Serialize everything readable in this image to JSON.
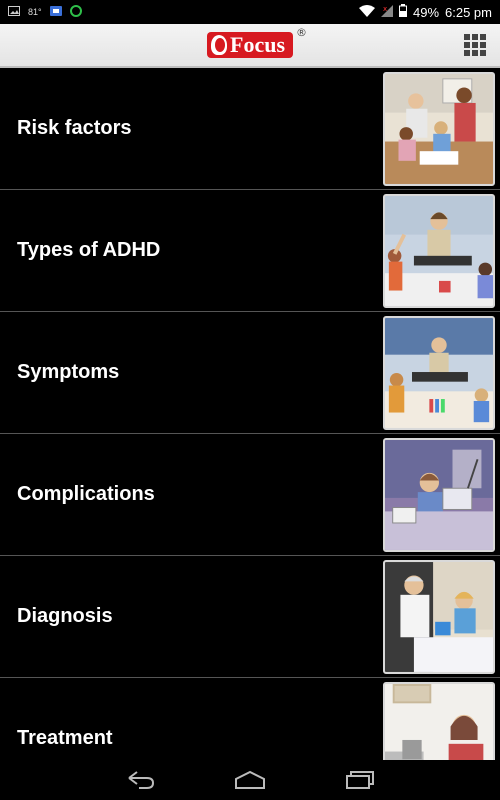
{
  "status_bar": {
    "temperature": "81°",
    "battery": "49%",
    "time": "6:25 pm"
  },
  "header": {
    "logo_text": "Focus",
    "logo_mark": "®",
    "brand_color": "#d71920"
  },
  "list": {
    "items": [
      {
        "label": "Risk factors",
        "image": "family-at-table-image"
      },
      {
        "label": "Types of ADHD",
        "image": "teacher-classroom-image"
      },
      {
        "label": "Symptoms",
        "image": "classroom-students-image"
      },
      {
        "label": "Complications",
        "image": "child-at-desk-image"
      },
      {
        "label": "Diagnosis",
        "image": "doctor-child-image"
      },
      {
        "label": "Treatment",
        "image": "counselor-office-image"
      }
    ]
  },
  "nav": {
    "back": "back-icon",
    "home": "home-icon",
    "recents": "recents-icon"
  }
}
